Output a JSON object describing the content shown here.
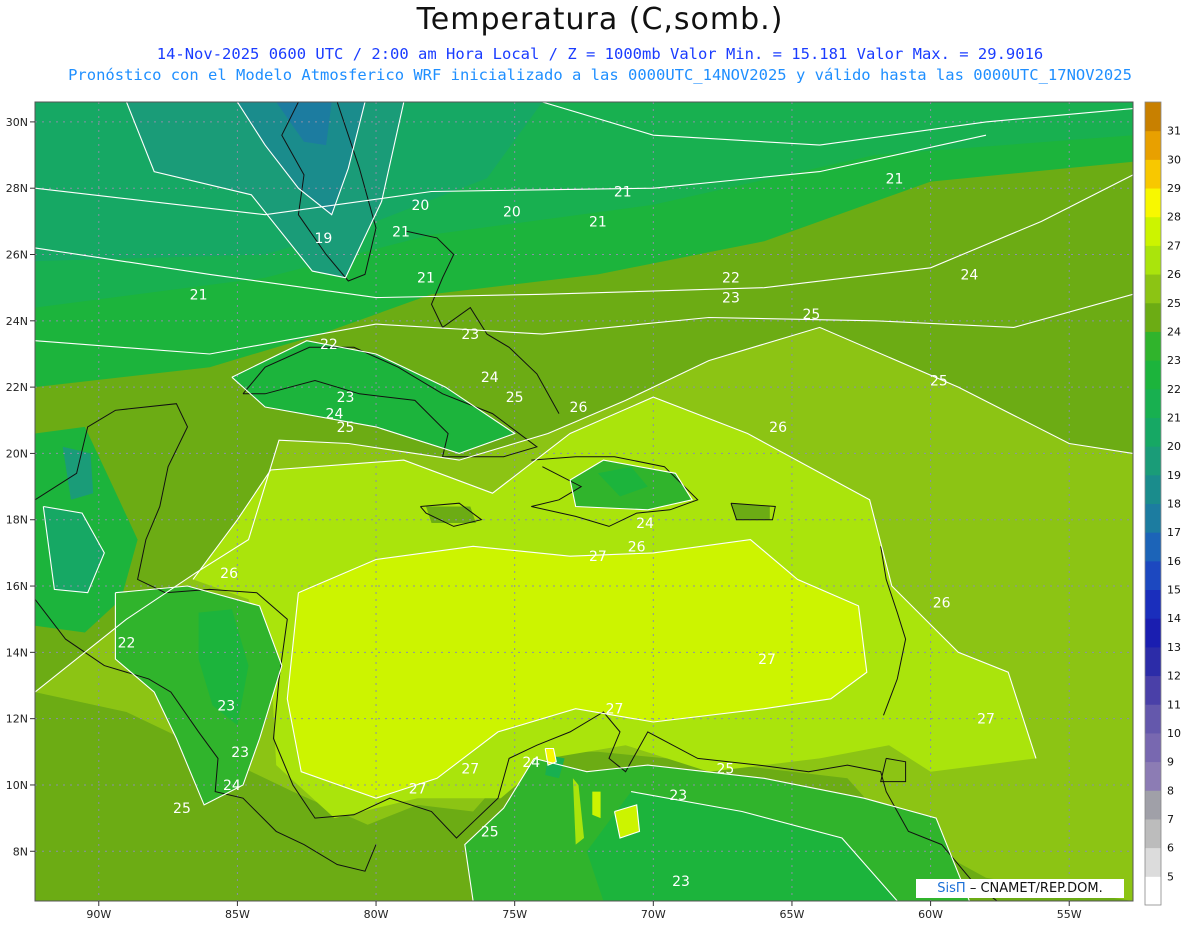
{
  "title": "Temperatura (C,somb.)",
  "subtitle1": "14-Nov-2025  0600 UTC / 2:00 am Hora Local / Z = 1000mb    Valor Min. = 15.181  Valor Max. = 29.9016",
  "subtitle2": "Pronóstico con el Modelo Atmosferico WRF inicializado a las 0000UTC_14NOV2025 y válido hasta las  0000UTC_17NOV2025",
  "credit": {
    "brand": "SisΠ",
    "text": "– CNAMET/REP.DOM."
  },
  "chart_data": {
    "type": "heatmap",
    "lon_range": [
      -92.3,
      -52.7
    ],
    "lat_range": [
      6.5,
      30.6
    ],
    "xticks": [
      "90W",
      "85W",
      "80W",
      "75W",
      "70W",
      "65W",
      "60W",
      "55W"
    ],
    "yticks": [
      "30N",
      "28N",
      "26N",
      "24N",
      "22N",
      "20N",
      "18N",
      "16N",
      "14N",
      "12N",
      "10N",
      "8N"
    ],
    "colorbar": {
      "labels": [
        "5",
        "6",
        "7",
        "8",
        "9",
        "10",
        "11",
        "12",
        "13",
        "14",
        "15",
        "16",
        "17",
        "18",
        "19",
        "20",
        "21",
        "22",
        "23",
        "24",
        "25",
        "26",
        "27",
        "28",
        "29",
        "30",
        "31"
      ],
      "colors": [
        "#ffffff",
        "#dcdcdc",
        "#bcbcbc",
        "#a0a0a8",
        "#8c7cb4",
        "#7868b0",
        "#6458ac",
        "#4a40a8",
        "#2c2ca8",
        "#1a1eb0",
        "#1a2ebc",
        "#1c48c0",
        "#1c64b8",
        "#1c7ca0",
        "#1a8c8c",
        "#1a9c78",
        "#16a864",
        "#18b050",
        "#1cb43c",
        "#30b42c",
        "#6cac14",
        "#8cc414",
        "#aae40c",
        "#ccf400",
        "#f8f800",
        "#f8c800",
        "#e8a000",
        "#c88000"
      ]
    },
    "contour_labels": [
      {
        "lon": -75.1,
        "lat": 27.3,
        "value": "20"
      },
      {
        "lon": -78.4,
        "lat": 27.5,
        "value": "20"
      },
      {
        "lon": -81.9,
        "lat": 26.5,
        "value": "19"
      },
      {
        "lon": -71.1,
        "lat": 27.9,
        "value": "21"
      },
      {
        "lon": -72.0,
        "lat": 27.0,
        "value": "21"
      },
      {
        "lon": -79.1,
        "lat": 26.7,
        "value": "21"
      },
      {
        "lon": -78.2,
        "lat": 25.3,
        "value": "21"
      },
      {
        "lon": -86.4,
        "lat": 24.8,
        "value": "21"
      },
      {
        "lon": -61.3,
        "lat": 28.3,
        "value": "21"
      },
      {
        "lon": -67.2,
        "lat": 25.3,
        "value": "22"
      },
      {
        "lon": -67.2,
        "lat": 24.7,
        "value": "23"
      },
      {
        "lon": -76.6,
        "lat": 23.6,
        "value": "23"
      },
      {
        "lon": -81.7,
        "lat": 23.3,
        "value": "22"
      },
      {
        "lon": -75.9,
        "lat": 22.3,
        "value": "24"
      },
      {
        "lon": -58.6,
        "lat": 25.4,
        "value": "24"
      },
      {
        "lon": -64.3,
        "lat": 24.2,
        "value": "25"
      },
      {
        "lon": -59.7,
        "lat": 22.2,
        "value": "25"
      },
      {
        "lon": -75.0,
        "lat": 21.7,
        "value": "25"
      },
      {
        "lon": -81.1,
        "lat": 21.7,
        "value": "23"
      },
      {
        "lon": -81.5,
        "lat": 21.2,
        "value": "24"
      },
      {
        "lon": -81.1,
        "lat": 20.8,
        "value": "25"
      },
      {
        "lon": -72.7,
        "lat": 21.4,
        "value": "26"
      },
      {
        "lon": -65.5,
        "lat": 20.8,
        "value": "26"
      },
      {
        "lon": -70.3,
        "lat": 17.9,
        "value": "24"
      },
      {
        "lon": -70.6,
        "lat": 17.2,
        "value": "26"
      },
      {
        "lon": -72.0,
        "lat": 16.9,
        "value": "27"
      },
      {
        "lon": -59.6,
        "lat": 15.5,
        "value": "26"
      },
      {
        "lon": -85.3,
        "lat": 16.4,
        "value": "26"
      },
      {
        "lon": -89.0,
        "lat": 14.3,
        "value": "22"
      },
      {
        "lon": -65.9,
        "lat": 13.8,
        "value": "27"
      },
      {
        "lon": -85.4,
        "lat": 12.4,
        "value": "23"
      },
      {
        "lon": -71.4,
        "lat": 12.3,
        "value": "27"
      },
      {
        "lon": -84.9,
        "lat": 11.0,
        "value": "23"
      },
      {
        "lon": -85.2,
        "lat": 10.0,
        "value": "24"
      },
      {
        "lon": -87.0,
        "lat": 9.3,
        "value": "25"
      },
      {
        "lon": -76.6,
        "lat": 10.5,
        "value": "27"
      },
      {
        "lon": -78.5,
        "lat": 9.9,
        "value": "27"
      },
      {
        "lon": -74.4,
        "lat": 10.7,
        "value": "24"
      },
      {
        "lon": -67.4,
        "lat": 10.5,
        "value": "25"
      },
      {
        "lon": -69.1,
        "lat": 9.7,
        "value": "23"
      },
      {
        "lon": -75.9,
        "lat": 8.6,
        "value": "25"
      },
      {
        "lon": -69.0,
        "lat": 7.1,
        "value": "23"
      },
      {
        "lon": -58.0,
        "lat": 12.0,
        "value": "27"
      }
    ],
    "xlabel": "",
    "ylabel": ""
  }
}
